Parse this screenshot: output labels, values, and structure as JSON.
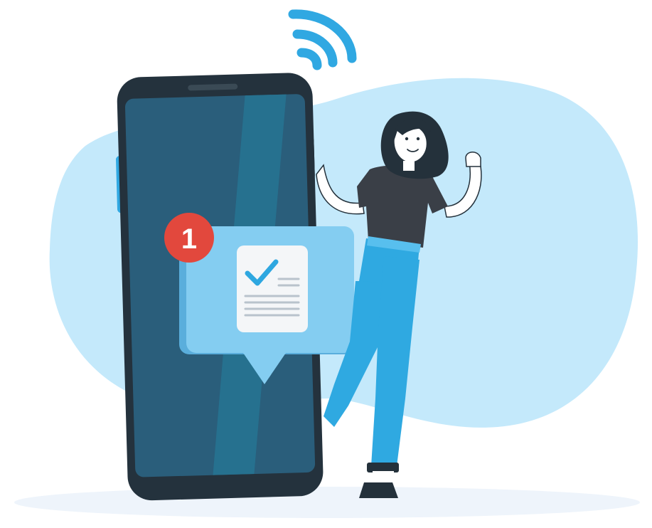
{
  "notification": {
    "count": "1"
  },
  "colors": {
    "blob": "#c4e9fb",
    "floor": "#eef4fb",
    "phone_frame": "#24323d",
    "phone_screen": "#2a5e7b",
    "phone_screen_highlight": "#26718f",
    "bubble_back": "#5aaedc",
    "bubble_front": "#84cdf1",
    "document": "#f4f6f8",
    "check": "#2ea7e0",
    "badge": "#e2483d",
    "wifi": "#30a8e2",
    "shirt": "#3a3f47",
    "jeans": "#2fa9e1",
    "hair": "#24313b",
    "skin": "#ffffff"
  },
  "icons": [
    "wifi-icon",
    "notification-badge",
    "checklist-document-icon"
  ]
}
